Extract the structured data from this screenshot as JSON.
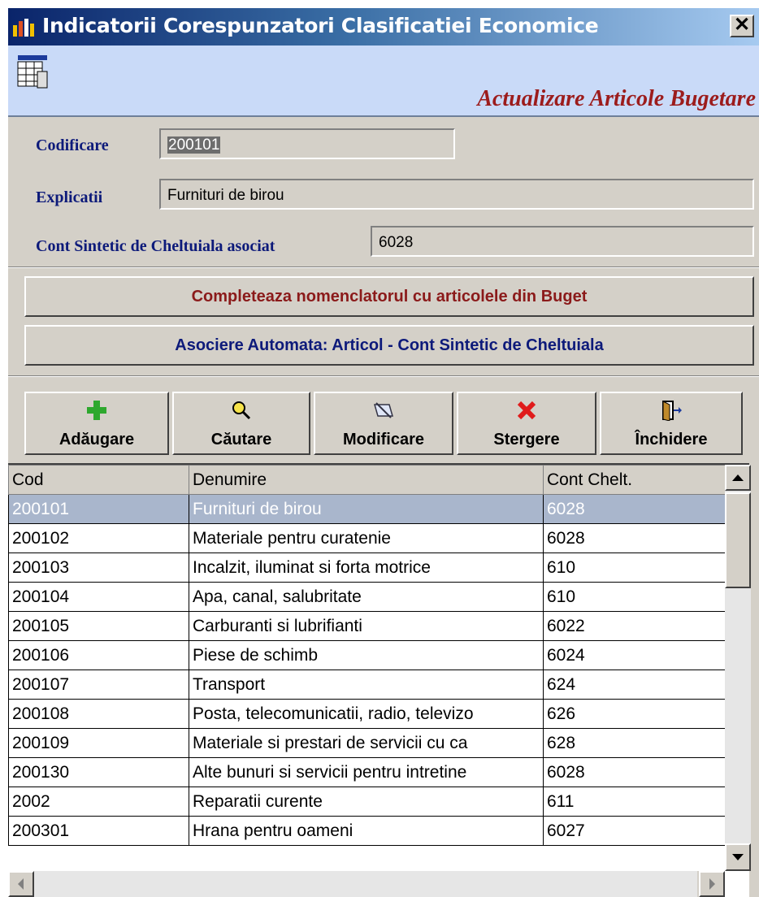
{
  "window": {
    "title": "Indicatorii Corespunzatori Clasificatiei Economice",
    "close_glyph": "✕",
    "subtitle": "Actualizare Articole Bugetare"
  },
  "form": {
    "codificare_label": "Codificare",
    "codificare_value": "200101",
    "explicatii_label": "Explicatii",
    "explicatii_value": "Furnituri de birou",
    "cont_label": "Cont Sintetic de Cheltuiala asociat",
    "cont_value": "6028"
  },
  "actions": {
    "completeaza_label": "Completeaza nomenclatorul cu articolele din Buget",
    "completeaza_color": "#8b1a1a",
    "asociere_label": "Asociere Automata: Articol - Cont Sintetic de Cheltuiala",
    "asociere_color": "#0d1a7a"
  },
  "toolbar": {
    "adaugare": "Adăugare",
    "cautare": "Căutare",
    "modificare": "Modificare",
    "stergere": "Stergere",
    "inchidere": "Închidere",
    "icons": [
      "plus-icon",
      "search-icon",
      "edit-icon",
      "delete-icon",
      "exit-door-icon"
    ]
  },
  "grid": {
    "columns": [
      "Cod",
      "Denumire",
      "Cont Chelt."
    ],
    "rows": [
      {
        "cod": "200101",
        "denumire": "Furnituri de birou",
        "cont": "6028"
      },
      {
        "cod": "200102",
        "denumire": "Materiale pentru curatenie",
        "cont": "6028"
      },
      {
        "cod": "200103",
        "denumire": "Incalzit, iluminat si forta motrice",
        "cont": "610"
      },
      {
        "cod": "200104",
        "denumire": "Apa, canal, salubritate",
        "cont": "610"
      },
      {
        "cod": "200105",
        "denumire": "Carburanti si lubrifianti",
        "cont": "6022"
      },
      {
        "cod": "200106",
        "denumire": "Piese de schimb",
        "cont": "6024"
      },
      {
        "cod": "200107",
        "denumire": "Transport",
        "cont": "624"
      },
      {
        "cod": "200108",
        "denumire": "Posta, telecomunicatii, radio, televizo",
        "cont": "626"
      },
      {
        "cod": "200109",
        "denumire": "Materiale si prestari de servicii cu ca",
        "cont": "628"
      },
      {
        "cod": "200130",
        "denumire": "Alte bunuri si servicii pentru intretine",
        "cont": "6028"
      },
      {
        "cod": "2002",
        "denumire": "Reparatii curente",
        "cont": "611"
      },
      {
        "cod": "200301",
        "denumire": "Hrana pentru oameni",
        "cont": "6027"
      }
    ],
    "selected_index": 0
  }
}
